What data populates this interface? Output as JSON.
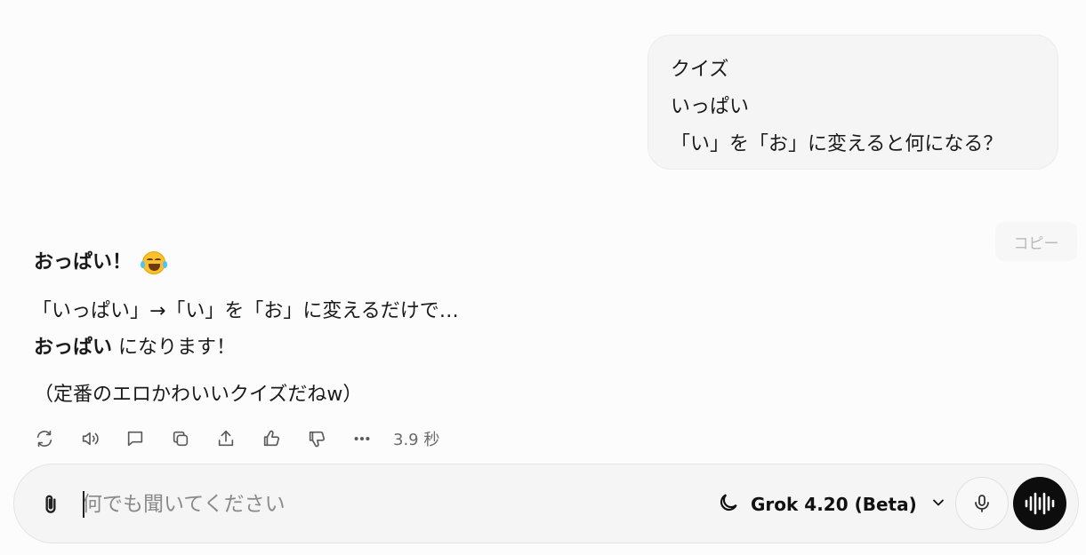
{
  "user_message": {
    "lines": [
      "クイズ",
      "いっぱい",
      "「い」を「お」に変えると何になる？"
    ]
  },
  "copy_label": "コピー",
  "assistant": {
    "title": "おっぱい！",
    "emoji": "laughing-with-tears-emoji",
    "line1": "「いっぱい」→「い」を「お」に変えるだけで…",
    "line2_bold": "おっぱい",
    "line2_rest": " になります！",
    "line3": "（定番のエロかわいいクイズだねw）"
  },
  "actions": {
    "icons": [
      "regenerate-icon",
      "read-aloud-icon",
      "comment-icon",
      "copy-icon",
      "share-icon",
      "thumbs-up-icon",
      "thumbs-down-icon",
      "more-icon"
    ],
    "timing": "3.9 秒"
  },
  "composer": {
    "placeholder": "何でも聞いてください",
    "model_label": "Grok 4.20 (Beta)"
  }
}
